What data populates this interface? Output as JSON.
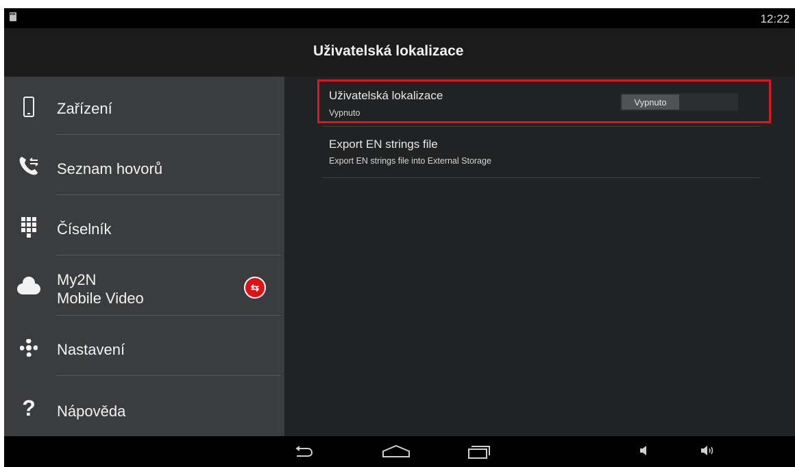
{
  "status_bar": {
    "time": "12:22",
    "icons": [
      "sd-card-icon"
    ]
  },
  "header": {
    "title": "Uživatelská lokalizace"
  },
  "sidebar": {
    "items": [
      {
        "label": "Zařízení",
        "icon": "phone-icon"
      },
      {
        "label": "Seznam hovorů",
        "icon": "call-log-icon"
      },
      {
        "label": "Číselník",
        "icon": "dialpad-icon"
      },
      {
        "label_line1": "My2N",
        "label_line2": "Mobile Video",
        "icon": "cloud-icon",
        "badge_icon": "sync-disconnected-icon"
      },
      {
        "label": "Nastavení",
        "icon": "gear-icon"
      },
      {
        "label": "Nápověda",
        "icon": "help-icon"
      }
    ]
  },
  "main": {
    "prefs": [
      {
        "title": "Uživatelská lokalizace",
        "summary": "Vypnuto",
        "toggle_label": "Vypnuto",
        "toggle_state": "off",
        "highlighted": true
      },
      {
        "title": "Export EN strings file",
        "summary": "Export EN strings file into External Storage"
      }
    ]
  },
  "nav_bar": {
    "buttons": [
      "back-icon",
      "home-icon",
      "recent-apps-icon",
      "volume-down-icon",
      "volume-up-icon"
    ]
  },
  "colors": {
    "highlight": "#e3141f",
    "badge": "#e10f16",
    "sidebar_bg": "#3a3c3d",
    "content_bg": "#212223"
  }
}
